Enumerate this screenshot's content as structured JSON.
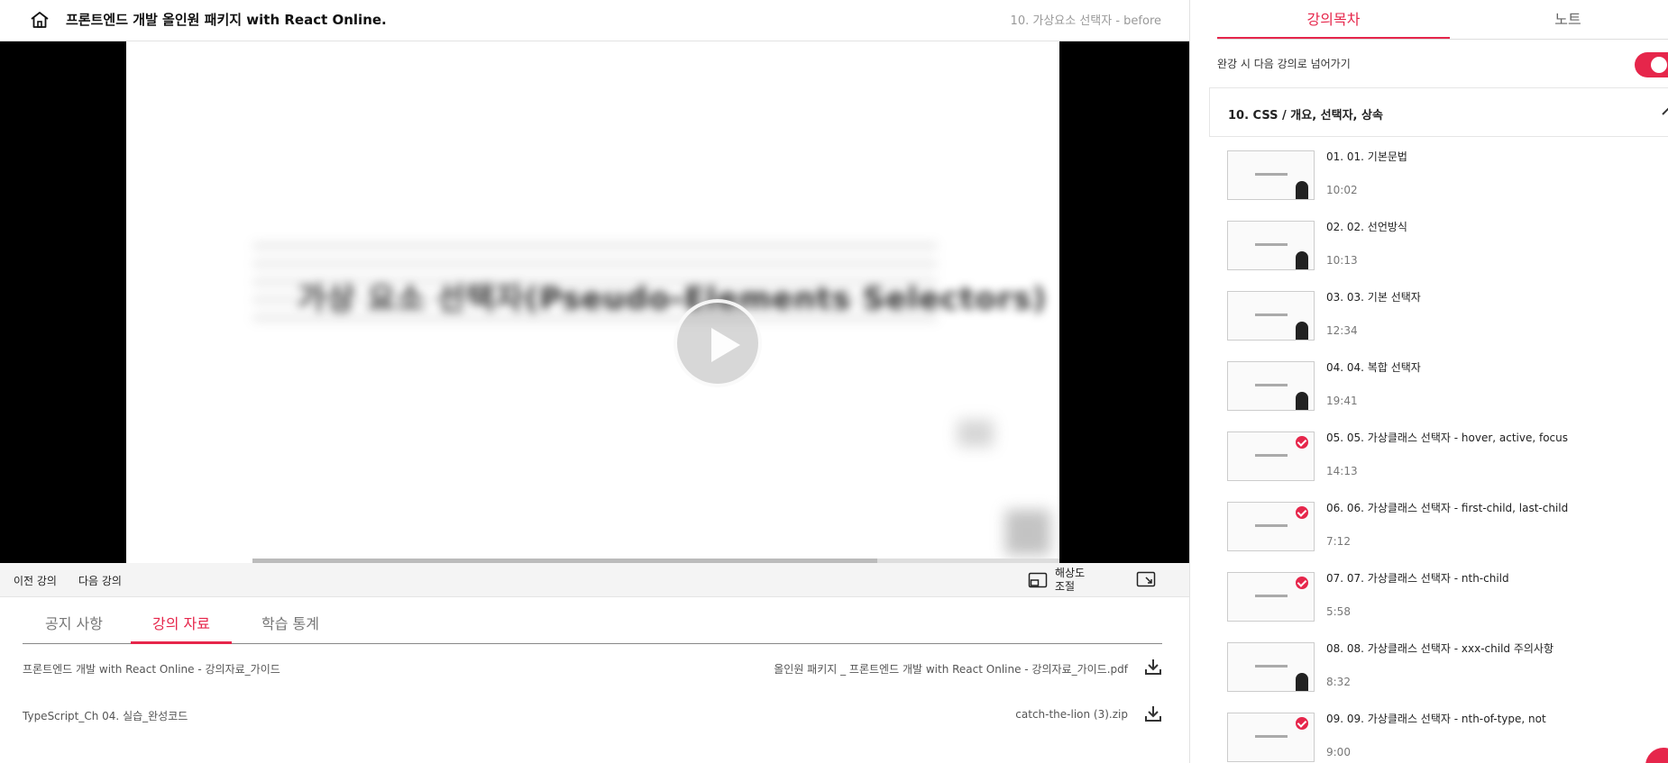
{
  "header": {
    "course_title": "프론트엔드 개발 올인원 패키지 with React Online.",
    "lecture_crumb": "10. 가상요소 선택자 - before"
  },
  "player": {
    "blurred_slide_text": "가상 요소 선택자(Pseudo-Elements Selectors)",
    "progress": 0.67
  },
  "controls": {
    "prev": "이전 강의",
    "next": "다음 강의",
    "resolution": "해상도 조절"
  },
  "bottom_tabs": [
    {
      "label": "공지 사항",
      "active": false
    },
    {
      "label": "강의 자료",
      "active": true
    },
    {
      "label": "학습 통계",
      "active": false
    }
  ],
  "materials": [
    {
      "name": "프론트엔드 개발 with React Online - 강의자료_가이드",
      "file": "올인원 패키지 _ 프론트엔드 개발 with React Online - 강의자료_가이드.pdf"
    },
    {
      "name": "TypeScript_Ch 04. 실습_완성코드",
      "file": "catch-the-lion (3).zip"
    }
  ],
  "sidebar": {
    "tabs": [
      {
        "label": "강의목차",
        "active": true
      },
      {
        "label": "노트",
        "active": false
      }
    ],
    "autoplay_label": "완강 시 다음 강의로 넘어가기",
    "autoplay_on": true,
    "section_title": "10. CSS / 개요, 선택자, 상속",
    "lessons": [
      {
        "title": "01. 01. 기본문법",
        "duration": "10:02",
        "done": false
      },
      {
        "title": "02. 02. 선언방식",
        "duration": "10:13",
        "done": false
      },
      {
        "title": "03. 03. 기본 선택자",
        "duration": "12:34",
        "done": false
      },
      {
        "title": "04. 04. 복합 선택자",
        "duration": "19:41",
        "done": false
      },
      {
        "title": "05. 05. 가상클래스 선택자 - hover, active, focus",
        "duration": "14:13",
        "done": true
      },
      {
        "title": "06. 06. 가상클래스 선택자 - first-child, last-child",
        "duration": "7:12",
        "done": true
      },
      {
        "title": "07. 07. 가상클래스 선택자 - nth-child",
        "duration": "5:58",
        "done": true
      },
      {
        "title": "08. 08. 가상클래스 선택자 - xxx-child 주의사항",
        "duration": "8:32",
        "done": false
      },
      {
        "title": "09. 09. 가상클래스 선택자 - nth-of-type, not",
        "duration": "9:00",
        "done": true
      }
    ]
  },
  "icons": {
    "home": "home-icon",
    "resolution": "picture-in-picture-icon",
    "popout": "popout-icon",
    "download": "download-icon",
    "chevron": "chevron-up-icon",
    "play": "play-icon"
  },
  "colors": {
    "accent": "#e6264b"
  }
}
